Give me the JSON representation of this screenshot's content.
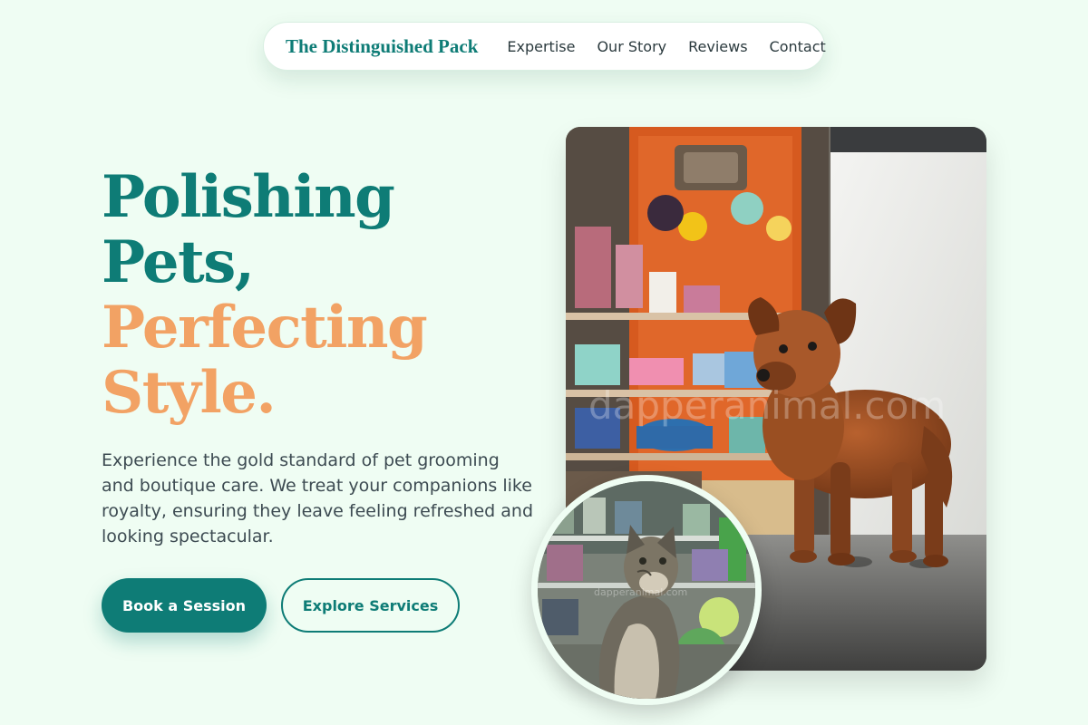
{
  "nav": {
    "brand": "The Distinguished Pack",
    "links": [
      "Expertise",
      "Our Story",
      "Reviews",
      "Contact"
    ]
  },
  "hero": {
    "headline_line1": "Polishing",
    "headline_line2": "Pets,",
    "headline_line3": "Perfecting",
    "headline_line4": "Style.",
    "lead": "Experience the gold standard of pet grooming and boutique care. We treat your companions like royalty, ensuring they leave feeling refreshed and looking spectacular.",
    "primary_button": "Book a Session",
    "secondary_button": "Explore Services"
  },
  "images": {
    "main_watermark": "dapperanimal.com",
    "circle_watermark": "dapperanimal.com"
  },
  "colors": {
    "background": "#effdf3",
    "accent_teal": "#0e7c76",
    "accent_peach": "#f2a264",
    "body_text": "#3d4b52"
  }
}
